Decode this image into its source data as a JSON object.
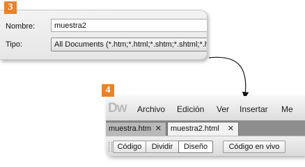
{
  "steps": {
    "first": "3",
    "second": "4"
  },
  "save_dialog": {
    "name_label": "Nombre:",
    "name_value": "muestra2",
    "type_label": "Tipo:",
    "type_value": "All Documents (*.htm;*.html;*.shtm;*.shtml;*.hta"
  },
  "dreamweaver": {
    "logo": "Dw",
    "menu": [
      "Archivo",
      "Edición",
      "Ver",
      "Insertar",
      "Me"
    ],
    "tabs": [
      {
        "label": "muestra.htm",
        "close": "✕"
      },
      {
        "label": "muestra2.html",
        "close": "✕"
      }
    ],
    "view_buttons": {
      "code": "Código",
      "split": "Dividir",
      "design": "Diseño",
      "live": "Código en vivo"
    }
  },
  "colors": {
    "badge": "#e8822b",
    "tabbar": "#8e8e8e",
    "active_tab": "#f2f2f2"
  }
}
